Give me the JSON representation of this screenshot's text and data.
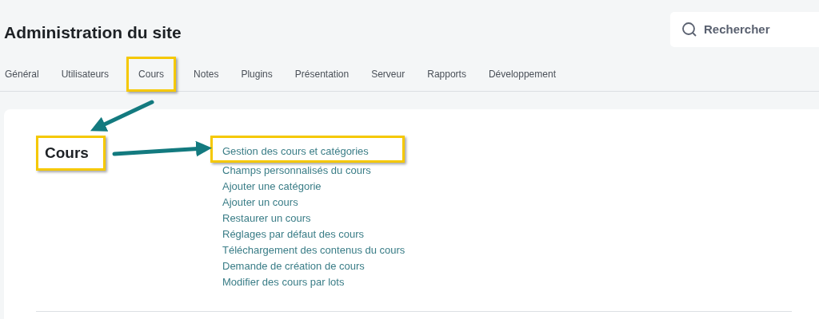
{
  "page_title": "Administration du site",
  "search": {
    "placeholder": "Rechercher"
  },
  "tabs": [
    {
      "label": "Général",
      "highlighted": false
    },
    {
      "label": "Utilisateurs",
      "highlighted": false
    },
    {
      "label": "Cours",
      "highlighted": true
    },
    {
      "label": "Notes",
      "highlighted": false
    },
    {
      "label": "Plugins",
      "highlighted": false
    },
    {
      "label": "Présentation",
      "highlighted": false
    },
    {
      "label": "Serveur",
      "highlighted": false
    },
    {
      "label": "Rapports",
      "highlighted": false
    },
    {
      "label": "Développement",
      "highlighted": false
    }
  ],
  "section": {
    "heading": "Cours",
    "highlighted": true,
    "links": [
      {
        "label": "Gestion des cours et catégories",
        "highlighted": true
      },
      {
        "label": "Champs personnalisés du cours",
        "highlighted": false
      },
      {
        "label": "Ajouter une catégorie",
        "highlighted": false
      },
      {
        "label": "Ajouter un cours",
        "highlighted": false
      },
      {
        "label": "Restaurer un cours",
        "highlighted": false
      },
      {
        "label": "Réglages par défaut des cours",
        "highlighted": false
      },
      {
        "label": "Téléchargement des contenus du cours",
        "highlighted": false
      },
      {
        "label": "Demande de création de cours",
        "highlighted": false
      },
      {
        "label": "Modifier des cours par lots",
        "highlighted": false
      }
    ]
  }
}
